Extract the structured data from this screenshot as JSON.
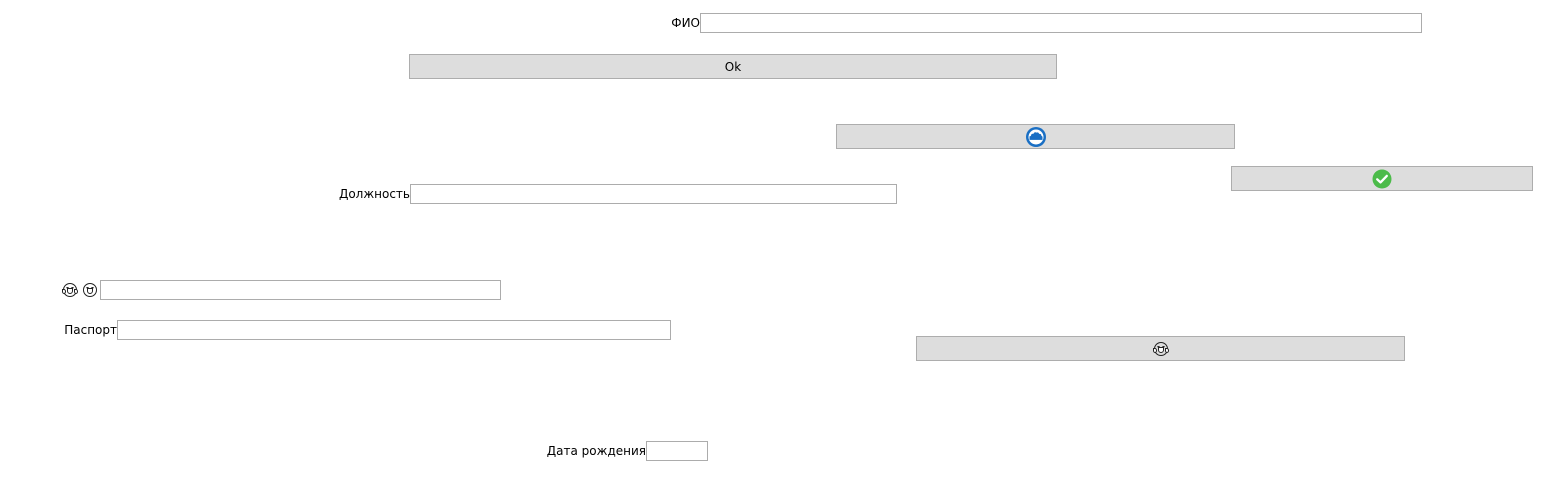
{
  "form": {
    "fio_label": "ФИО",
    "fio_value": "",
    "ok_button_label": "Ok",
    "position_label": "Должность",
    "position_value": "",
    "emoji_label_icons": [
      "joy-emoji-icon",
      "grinning-emoji-icon"
    ],
    "emoji_field_value": "",
    "passport_label": "Паспорт",
    "passport_value": "",
    "birthdate_label": "Дата рождения",
    "birthdate_value": ""
  },
  "icon_buttons": [
    {
      "icon": "blue-cloud-circle-icon",
      "color": "#1a6fc4"
    },
    {
      "icon": "green-check-circle-icon",
      "color": "#4cbb4a"
    },
    {
      "icon": "joy-emoji-icon",
      "color": "#222222"
    }
  ]
}
